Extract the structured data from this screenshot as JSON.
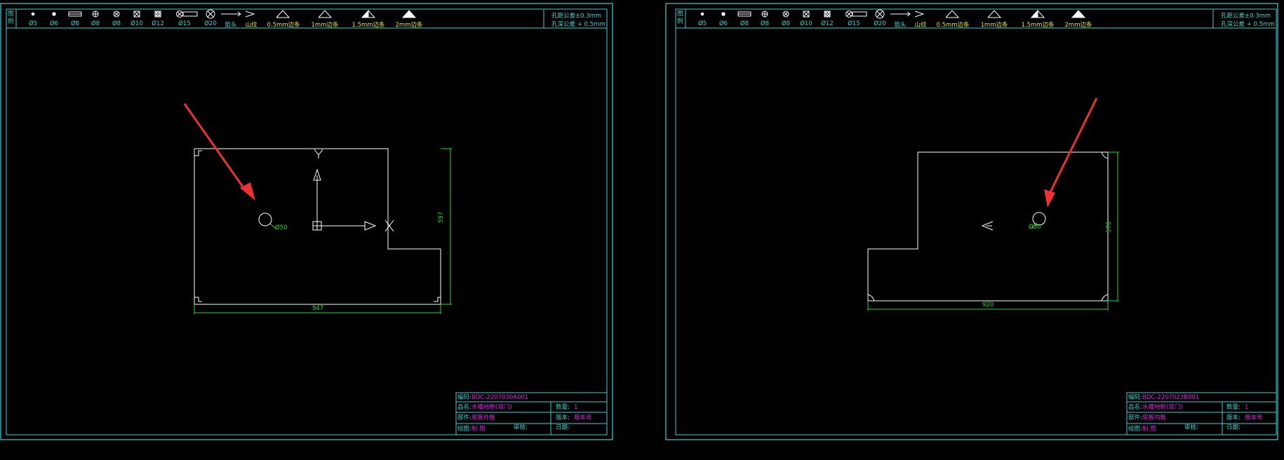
{
  "legend": {
    "side_label_1": "图",
    "side_label_2": "例",
    "items": [
      "Ø5",
      "Ø6",
      "Ø8",
      "Ø8",
      "Ø8",
      "Ø10",
      "Ø12",
      "Ø15",
      "Ø20",
      "箭头",
      "山纹",
      "0.5mm边条",
      "1mm边条",
      "1.5mm边条",
      "2mm边条"
    ]
  },
  "tolerance": {
    "line1": "孔距公差±0.3mm",
    "line2": "孔深公差 + 0.5mm"
  },
  "drawings": [
    {
      "hole_label": "Ø50",
      "dim_width": "947",
      "dim_height": "597",
      "title_block": {
        "code_label": "编码:",
        "code_value": "BDC-2207030A001",
        "product_label": "品名:",
        "product_value": "水槽地柜(双门)",
        "qty_label": "数量:",
        "qty_value": "1",
        "part_label": "部件:",
        "part_value": "底板外板",
        "version_label": "版本:",
        "version_value": "版本号",
        "drawer_label": "绘图:",
        "drawer_value": "制 图",
        "review_label": "审核:",
        "date_label": "日期:"
      }
    },
    {
      "hole_label": "Ø50",
      "dim_width": "920",
      "dim_height": "570",
      "title_block": {
        "code_label": "编码:",
        "code_value": "BDC-2207023B001",
        "product_label": "品名:",
        "product_value": "水槽地柜(双门)",
        "qty_label": "数量:",
        "qty_value": "1",
        "part_label": "部件:",
        "part_value": "底板内板",
        "version_label": "版本:",
        "version_value": "版本号",
        "drawer_label": "绘图:",
        "drawer_value": "制 图",
        "review_label": "审核:",
        "date_label": "日期:"
      }
    }
  ],
  "colors": {
    "background": "#000000",
    "frame": "#3fd0d0",
    "geometry": "#ffffff",
    "dimension": "#22dd22",
    "title_values": "#e020e0",
    "arrow": "#ee3030"
  }
}
